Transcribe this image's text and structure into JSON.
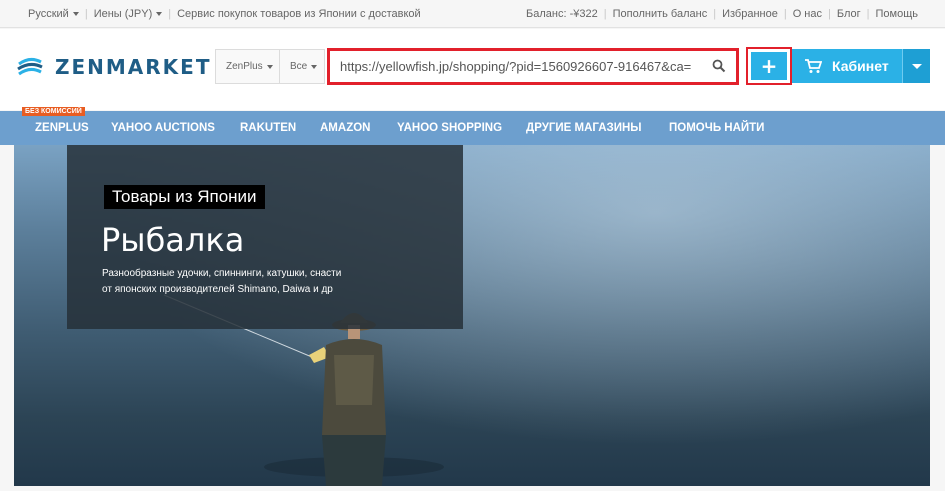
{
  "topbar": {
    "language": "Русский",
    "currency": "Иены (JPY)",
    "tagline": "Сервис покупок товаров из Японии с доставкой",
    "balance": "Баланс: -¥322",
    "topup": "Пополнить баланс",
    "favorites": "Избранное",
    "about": "О нас",
    "blog": "Блог",
    "help": "Помощь"
  },
  "header": {
    "logo_text": "ZENMARKET",
    "filter_zenplus": "ZenPlus",
    "filter_all": "Все",
    "search_value": "https://yellowfish.jp/shopping/?pid=1560926607-916467&ca=",
    "add_label": "+",
    "cabinet_label": "Кабинет"
  },
  "nav": {
    "badge": "БЕЗ КОМИССИЙ",
    "items": [
      "ZENPLUS",
      "YAHOO AUCTIONS",
      "RAKUTEN",
      "AMAZON",
      "YAHOO SHOPPING",
      "ДРУГИЕ МАГАЗИНЫ",
      "ПОМОЧЬ НАЙТИ"
    ]
  },
  "banner": {
    "tag": "Товары из Японии",
    "title": "Рыбалка",
    "desc_line1": "Разнообразные удочки, спиннинги, катушки, снасти",
    "desc_line2": "от японских производителей Shimano, Daiwa и др"
  },
  "colors": {
    "accent": "#2bb1e6",
    "nav": "#6d9fce",
    "highlight": "#e2202b",
    "badge": "#e85d22",
    "logo": "#1f5d86"
  }
}
